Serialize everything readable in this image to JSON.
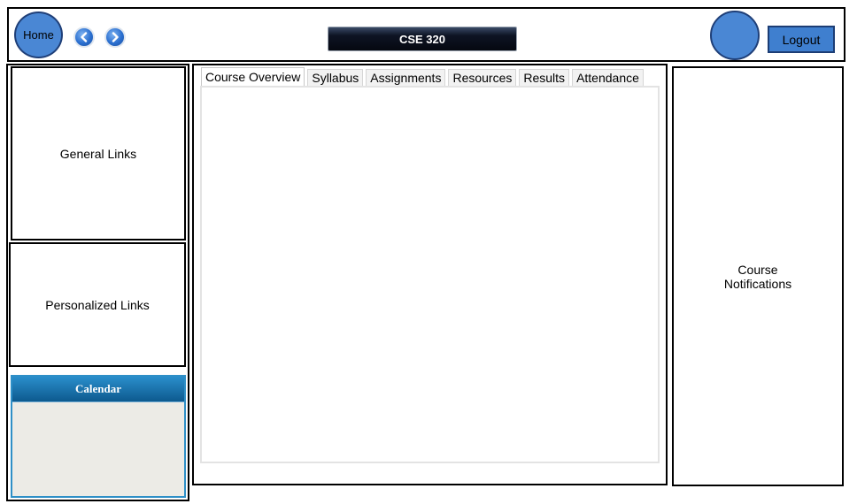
{
  "header": {
    "home_label": "Home",
    "course_title": "CSE 320",
    "logout_label": "Logout"
  },
  "sidebar": {
    "general_links": "General Links",
    "personalized_links": "Personalized Links",
    "calendar_title": "Calendar"
  },
  "main": {
    "tabs": [
      {
        "label": "Course Overview",
        "active": true
      },
      {
        "label": "Syllabus"
      },
      {
        "label": "Assignments"
      },
      {
        "label": "Resources"
      },
      {
        "label": "Results"
      },
      {
        "label": "Attendance"
      }
    ]
  },
  "right_panel": {
    "notifications_label": "Course Notifications"
  },
  "colors": {
    "accent_blue": "#4a87d4",
    "calendar_header": "#0d5a8f",
    "title_bar": "#0e1424"
  }
}
